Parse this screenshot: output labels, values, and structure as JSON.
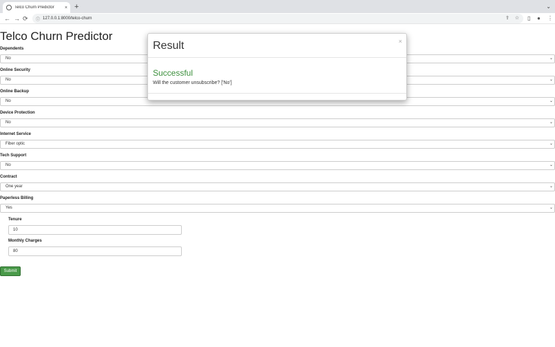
{
  "browser": {
    "tab_title": "Telco Churn Predictor",
    "tab_close": "×",
    "new_tab": "+",
    "tab_menu": "⌄",
    "back": "←",
    "forward": "→",
    "reload": "⟳",
    "site_info": "ⓘ",
    "url": "127.0.0.1:8000/telco-churn"
  },
  "page": {
    "title": "Telco Churn Predictor",
    "selects": [
      {
        "label": "Dependents",
        "value": "No"
      },
      {
        "label": "Online Security",
        "value": "No"
      },
      {
        "label": "Online Backup",
        "value": "No"
      },
      {
        "label": "Device Protection",
        "value": "No"
      },
      {
        "label": "Internet Service",
        "value": "Fiber optic"
      },
      {
        "label": "Tech Support",
        "value": "No"
      },
      {
        "label": "Contract",
        "value": "One year"
      },
      {
        "label": "Paperless Billing",
        "value": "Yes"
      }
    ],
    "tenure": {
      "label": "Tenure",
      "value": "10"
    },
    "monthly_charges": {
      "label": "Monthly Charges",
      "value": "80"
    },
    "submit_label": "Submit"
  },
  "modal": {
    "title": "Result",
    "close": "×",
    "status": "Successful",
    "message": "Will the customer unsubscribe? ['No']"
  },
  "colors": {
    "success": "#3c8f3c",
    "submit_bg": "#4a9a4a"
  }
}
